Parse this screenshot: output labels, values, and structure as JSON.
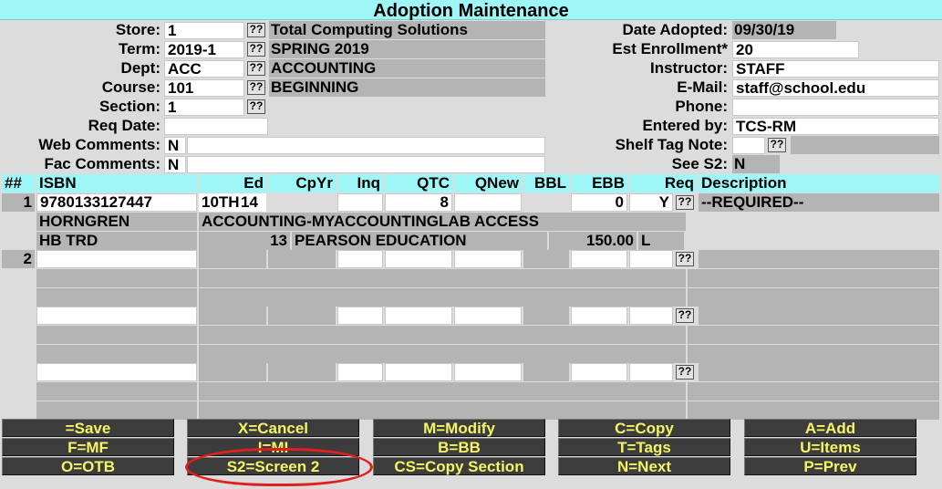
{
  "title": "Adoption Maintenance",
  "header": {
    "store_label": "Store:",
    "store_value": "1",
    "store_name": "Total Computing Solutions",
    "term_label": "Term:",
    "term_value": "2019-1",
    "term_name": "SPRING 2019",
    "dept_label": "Dept:",
    "dept_value": "ACC",
    "dept_name": "ACCOUNTING",
    "course_label": "Course:",
    "course_value": "101",
    "course_name": "BEGINNING",
    "section_label": "Section:",
    "section_value": "1",
    "req_date_label": "Req Date:",
    "req_date_value": "",
    "web_comments_label": "Web Comments:",
    "web_comments_flag": "N",
    "web_comments_text": "",
    "fac_comments_label": "Fac Comments:",
    "fac_comments_flag": "N",
    "fac_comments_text": "",
    "date_adopted_label": "Date Adopted:",
    "date_adopted_value": "09/30/19",
    "est_enrollment_label": "Est Enrollment*",
    "est_enrollment_value": "20",
    "instructor_label": "Instructor:",
    "instructor_value": "STAFF",
    "email_label": "E-Mail:",
    "email_value": "staff@school.edu",
    "phone_label": "Phone:",
    "phone_value": "",
    "entered_by_label": "Entered by:",
    "entered_by_value": "TCS-RM",
    "shelf_tag_label": "Shelf Tag Note:",
    "shelf_tag_value": "",
    "see_s2_label": "See S2:",
    "see_s2_value": "N",
    "lookup_glyph": "??"
  },
  "grid": {
    "columns": [
      "##",
      "ISBN",
      "Ed",
      "CpYr",
      "Inq",
      "QTC",
      "QNew",
      "BBL",
      "EBB",
      "Req",
      "Description"
    ],
    "rows": [
      {
        "num": "1",
        "isbn": "9780133127447",
        "ed": "10TH",
        "cpyr": "14",
        "inq": "",
        "qtc": "8",
        "qnew": "",
        "bbl": "",
        "ebb": "0",
        "req": "Y",
        "description": "--REQUIRED--",
        "author": "HORNGREN",
        "book_title": "ACCOUNTING-MYACCOUNTINGLAB ACCESS",
        "binding": "HB TRD",
        "pub_code": "13",
        "publisher": "PEARSON EDUCATION",
        "price": "150.00",
        "price_flag": "L"
      },
      {
        "num": "2"
      },
      {
        "num": ""
      },
      {
        "num": ""
      }
    ]
  },
  "buttons": [
    [
      "=Save",
      "X=Cancel",
      "M=Modify",
      "C=Copy",
      "A=Add"
    ],
    [
      "F=MF",
      "I=MI",
      "B=BB",
      "T=Tags",
      "U=Items"
    ],
    [
      "O=OTB",
      "S2=Screen 2",
      "CS=Copy Section",
      "N=Next",
      "P=Prev"
    ]
  ],
  "colors": {
    "title_bg": "#9ef6f6",
    "button_bg": "#3c3c3c",
    "button_text": "#f4f464",
    "annotation": "#e0201e"
  }
}
